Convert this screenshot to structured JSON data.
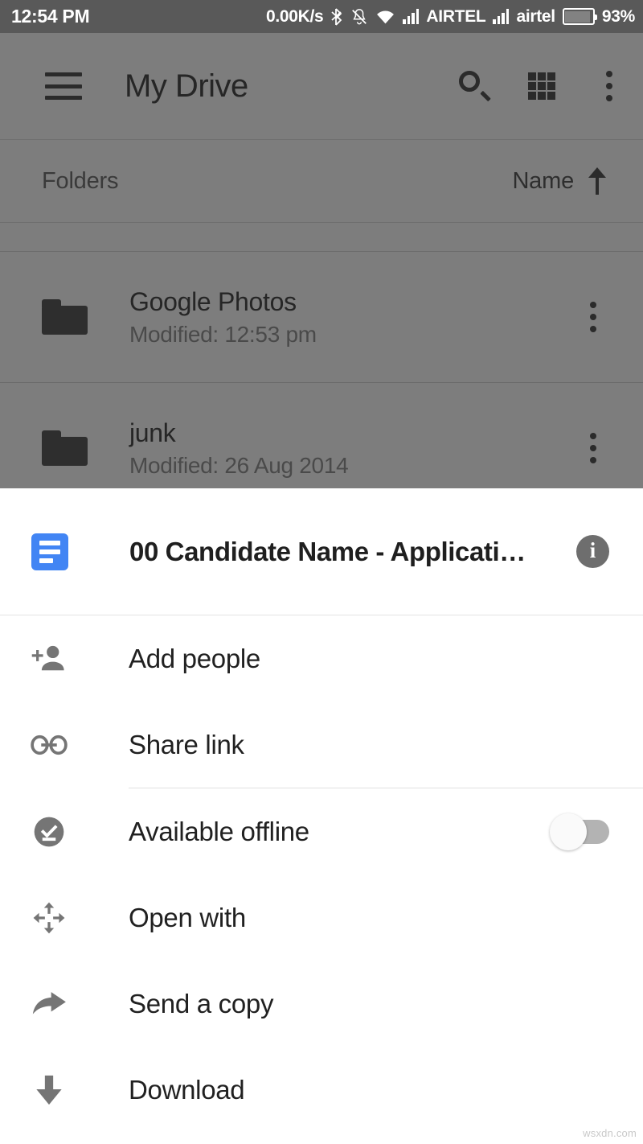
{
  "status_bar": {
    "clock": "12:54 PM",
    "network_speed": "0.00K/s",
    "bluetooth_icon": "bluetooth-icon",
    "mute_icon": "notifications-off-icon",
    "wifi_icon": "wifi-icon",
    "sim1_signal_icon": "signal-bars-icon",
    "sim1_carrier": "AIRTEL",
    "sim2_signal_icon": "signal-bars-icon",
    "sim2_carrier": "airtel",
    "battery_icon": "battery-icon",
    "battery_level": "93%"
  },
  "toolbar": {
    "menu_icon": "hamburger-menu-icon",
    "title": "My Drive",
    "search_icon": "search-icon",
    "grid_icon": "grid-view-icon",
    "overflow_icon": "more-vert-icon"
  },
  "sort_bar": {
    "section_label": "Folders",
    "sort_by": "Name",
    "sort_direction_icon": "arrow-up-icon"
  },
  "folders": [
    {
      "icon": "folder-icon",
      "name": "Google Photos",
      "modified": "Modified: 12:53 pm",
      "overflow_icon": "more-vert-icon"
    },
    {
      "icon": "folder-icon",
      "name": "junk",
      "modified": "Modified: 26 Aug 2014",
      "overflow_icon": "more-vert-icon"
    }
  ],
  "sheet": {
    "file_icon": "google-docs-icon",
    "file_name": "00 Candidate Name - Applicati…",
    "info_icon": "info-icon",
    "items": [
      {
        "icon": "person-add-icon",
        "label": "Add people"
      },
      {
        "icon": "link-icon",
        "label": "Share link"
      },
      {
        "icon": "offline-pin-icon",
        "label": "Available offline",
        "toggle": "off"
      },
      {
        "icon": "open-with-icon",
        "label": "Open with"
      },
      {
        "icon": "send-copy-icon",
        "label": "Send a copy"
      },
      {
        "icon": "download-icon",
        "label": "Download"
      }
    ]
  },
  "colors": {
    "docs_blue": "#4285F4",
    "icon_gray": "#757575",
    "scrim_gray": "#7D7D7D",
    "status_bar_gray": "#595959"
  },
  "watermark": "wsxdn.com"
}
